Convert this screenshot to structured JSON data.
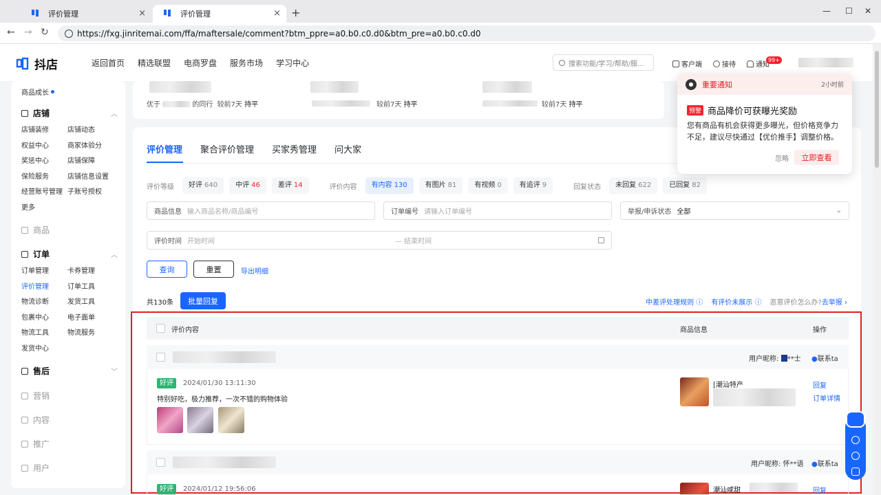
{
  "browser": {
    "tabs": [
      {
        "title": "评价管理",
        "active": false
      },
      {
        "title": "评价管理",
        "active": true
      }
    ],
    "url": "https://fxg.jinritemai.com/ffa/maftersale/comment?btm_ppre=a0.b0.c0.d0&btm_pre=a0.b0.c0.d0"
  },
  "topnav": {
    "brand": "抖店",
    "links": [
      "返回首页",
      "精选联盟",
      "电商罗盘",
      "服务市场",
      "学习中心"
    ],
    "search_placeholder": "搜索功能/学习/帮助/服...",
    "tools": [
      "客户端",
      "接待",
      "通知"
    ],
    "notif_badge": "99+"
  },
  "sidebar": {
    "top_item": "商品成长",
    "shop": {
      "title": "店铺",
      "items": [
        "店铺装修",
        "店铺动态",
        "权益中心",
        "商家体验分",
        "奖惩中心",
        "店铺保障",
        "保险服务",
        "店铺信息设置",
        "经营账号管理",
        "子账号授权",
        "更多"
      ]
    },
    "goods": {
      "title": "商品"
    },
    "order": {
      "title": "订单",
      "items": [
        "订单管理",
        "卡券管理",
        "评价管理",
        "订单工具",
        "物流诊断",
        "发货工具",
        "包裹中心",
        "电子面单",
        "物流工具",
        "物流服务",
        "发货中心"
      ],
      "active": "评价管理"
    },
    "aftersale": {
      "title": "售后"
    },
    "collapsed": [
      "营销",
      "内容",
      "推广",
      "用户"
    ]
  },
  "stats": [
    {
      "text": "优于",
      "suffix": "的同行",
      "compare": "较前7天",
      "trend": "持平"
    },
    {
      "text": "",
      "compare": "较前7天",
      "trend": "持平"
    },
    {
      "text": "",
      "compare": "较前7天",
      "trend": "持平"
    }
  ],
  "main": {
    "tabs": [
      "评价管理",
      "聚合评价管理",
      "买家秀管理",
      "问大家"
    ],
    "active_tab": "评价管理",
    "level": {
      "label": "评价等级",
      "chips": [
        {
          "name": "好评",
          "count": "640"
        },
        {
          "name": "中评",
          "count": "46"
        },
        {
          "name": "差评",
          "count": "14"
        }
      ]
    },
    "content": {
      "label": "评价内容",
      "chips": [
        {
          "name": "有内容",
          "count": "130"
        },
        {
          "name": "有图片",
          "count": "81"
        },
        {
          "name": "有视频",
          "count": "0"
        },
        {
          "name": "有追评",
          "count": "9"
        }
      ]
    },
    "reply": {
      "label": "回复状态",
      "chips": [
        {
          "name": "未回复",
          "count": "622"
        },
        {
          "name": "已回复",
          "count": "82"
        }
      ]
    },
    "form": {
      "goods_label": "商品信息",
      "goods_ph": "输入商品名称/商品编号",
      "order_label": "订单编号",
      "order_ph": "请输入订单编号",
      "report_label": "举报/申诉状态",
      "report_val": "全部",
      "time_label": "评价时间",
      "time_start": "开始时间",
      "time_end": "— 结束时间"
    },
    "buttons": {
      "query": "查询",
      "reset": "重置",
      "export": "导出明细",
      "batch": "批量回复"
    },
    "total": "共130条",
    "rules": {
      "r1": "中差评处理规则",
      "r2": "有评价未展示",
      "r3": "恶意评价怎么办?",
      "r4": "去举报"
    },
    "table": {
      "col_content": "评价内容",
      "col_goods": "商品信息",
      "col_op": "操作"
    },
    "rows": [
      {
        "nick_label": "用户昵称:",
        "nick": "**士",
        "contact": "联系ta",
        "tag": "好评",
        "time": "2024/01/30 13:11:30",
        "text": "特别好吃，极力推荐，一次不错的购物体验",
        "goods": "[潮汕特产",
        "ops": [
          "回复",
          "订单详情"
        ]
      },
      {
        "nick_label": "用户昵称:",
        "nick": "怀**语",
        "contact": "联系ta",
        "tag": "好评",
        "time": "2024/01/12 19:56:06",
        "text": "",
        "goods": "潮汕咸甜",
        "ops": [
          "回复"
        ]
      }
    ]
  },
  "notification": {
    "header": "重要通知",
    "time": "2小时前",
    "pill": "预警",
    "title": "商品降价可获曝光奖励",
    "body": "您有商品有机会获得更多曝光，但价格竞争力不足，建议尽快通过【优价推手】调整价格。",
    "ignore": "忽略",
    "action": "立即查看"
  },
  "colors": {
    "accent": "#1966ff",
    "danger": "#f5222d",
    "good": "#2bb673"
  }
}
